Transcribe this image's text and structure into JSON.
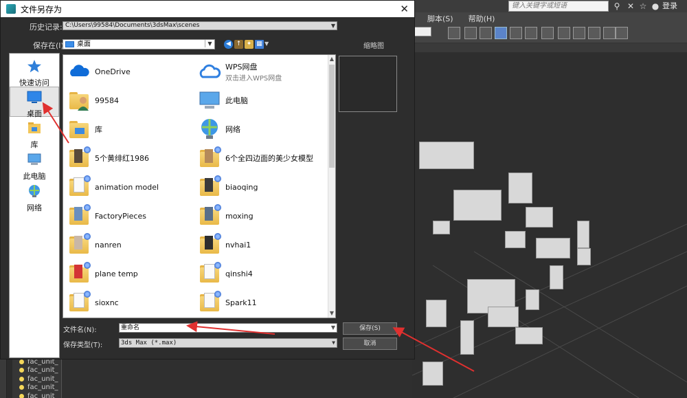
{
  "app": {
    "search_placeholder": "键入关键字或短语",
    "login_label": "登录",
    "menu": [
      "脚本(S)",
      "帮助(H)"
    ],
    "scene_items": [
      "fac_unit_",
      "fac_unit_",
      "fac_unit_",
      "fac_unit_",
      "fac_unit_"
    ]
  },
  "dialog": {
    "title": "文件另存为",
    "history_label": "历史记录:",
    "history_value": "C:\\Users\\99584\\Documents\\3dsMax\\scenes",
    "save_in_label": "保存在(I):",
    "save_in_value": "桌面",
    "thumbnail_label": "缩略图",
    "places": [
      {
        "label": "快速访问",
        "icon": "star-icon"
      },
      {
        "label": "桌面",
        "icon": "desktop-icon",
        "selected": true
      },
      {
        "label": "库",
        "icon": "library-icon"
      },
      {
        "label": "此电脑",
        "icon": "computer-icon"
      },
      {
        "label": "网络",
        "icon": "network-icon"
      }
    ],
    "files_left": [
      {
        "name": "OneDrive",
        "icon": "cloud-icon"
      },
      {
        "name": "99584",
        "icon": "user-folder-icon"
      },
      {
        "name": "库",
        "icon": "library-folder-icon"
      },
      {
        "name": "5个黄绯红1986",
        "icon": "folder-icon"
      },
      {
        "name": "animation model",
        "icon": "folder-icon"
      },
      {
        "name": "FactoryPieces",
        "icon": "folder-icon"
      },
      {
        "name": "nanren",
        "icon": "folder-icon"
      },
      {
        "name": "plane temp",
        "icon": "folder-icon"
      },
      {
        "name": "sioxnc",
        "icon": "folder-icon"
      }
    ],
    "files_right": [
      {
        "name": "WPS网盘",
        "sub": "双击进入WPS网盘",
        "icon": "wps-cloud-icon"
      },
      {
        "name": "此电脑",
        "icon": "computer-icon"
      },
      {
        "name": "网络",
        "icon": "network-icon"
      },
      {
        "name": "6个全四边面的美少女模型",
        "icon": "folder-icon"
      },
      {
        "name": "biaoqing",
        "icon": "folder-icon"
      },
      {
        "name": "moxing",
        "icon": "folder-icon"
      },
      {
        "name": "nvhai1",
        "icon": "folder-icon"
      },
      {
        "name": "qinshi4",
        "icon": "folder-icon"
      },
      {
        "name": "Spark11",
        "icon": "folder-icon"
      }
    ],
    "filename_label": "文件名(N):",
    "filename_value": "重命名",
    "filetype_label": "保存类型(T):",
    "filetype_value": "3ds Max (*.max)",
    "save_button": "保存(S)",
    "cancel_button": "取消",
    "accent_color": "#e0302f"
  }
}
